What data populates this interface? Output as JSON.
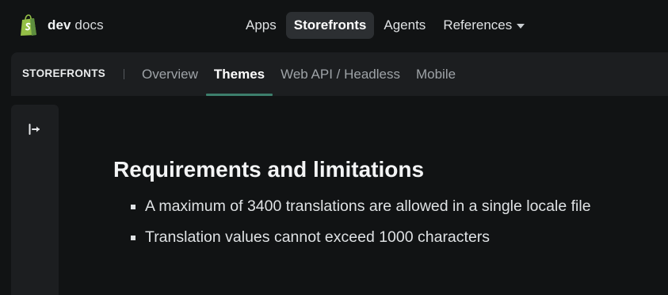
{
  "brand": {
    "logo_icon": "shopify-bag-icon",
    "name_bold": "dev",
    "name_regular": "docs",
    "accent_color": "#95bf47"
  },
  "topnav": {
    "items": [
      {
        "label": "Apps",
        "active": false
      },
      {
        "label": "Storefronts",
        "active": true
      },
      {
        "label": "Agents",
        "active": false
      },
      {
        "label": "References",
        "active": false,
        "icon": "caret-down-icon"
      }
    ]
  },
  "subnav": {
    "section_label": "STOREFRONTS",
    "tabs": [
      {
        "label": "Overview",
        "active": false
      },
      {
        "label": "Themes",
        "active": true
      },
      {
        "label": "Web API / Headless",
        "active": false
      },
      {
        "label": "Mobile",
        "active": false
      }
    ],
    "active_indicator_color": "#3d7f6c"
  },
  "sidebar": {
    "toggle_icon": "expand-sidebar-icon"
  },
  "content": {
    "heading": "Requirements and limitations",
    "bullets": [
      "A maximum of 3400 translations are allowed in a single locale file",
      "Translation values cannot exceed 1000 characters"
    ]
  }
}
